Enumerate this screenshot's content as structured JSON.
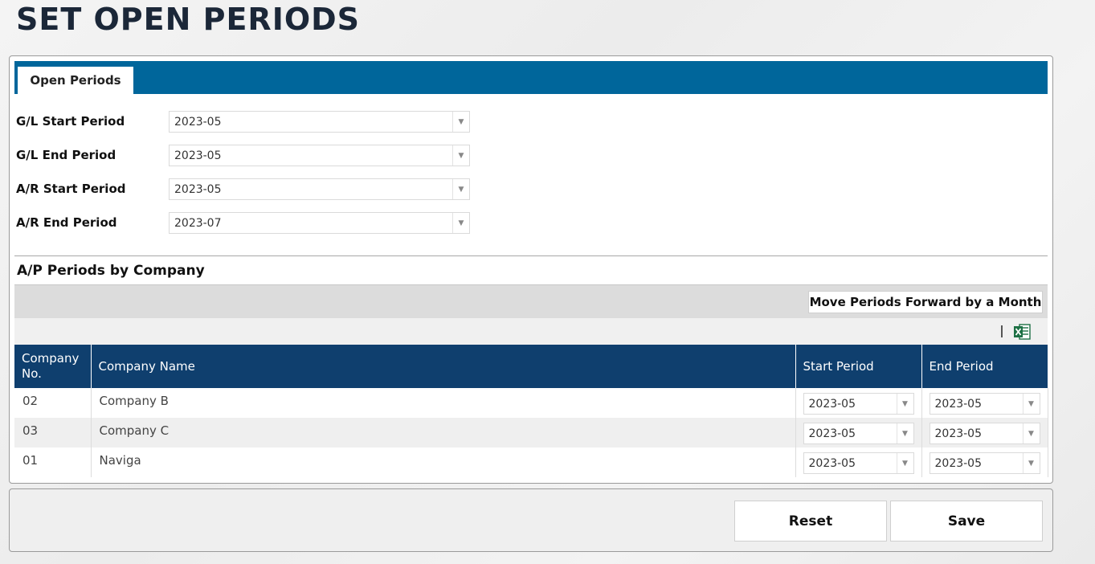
{
  "page": {
    "title": "SET OPEN PERIODS"
  },
  "tabs": [
    {
      "label": "Open Periods"
    }
  ],
  "periods": {
    "gl_start": {
      "label": "G/L Start Period",
      "value": "2023-05"
    },
    "gl_end": {
      "label": "G/L End Period",
      "value": "2023-05"
    },
    "ar_start": {
      "label": "A/R Start Period",
      "value": "2023-05"
    },
    "ar_end": {
      "label": "A/R End Period",
      "value": "2023-07"
    }
  },
  "ap_section": {
    "title": "A/P Periods by Company",
    "move_button_label": "Move Periods Forward by a Month",
    "excel_icon": "excel-export-icon",
    "columns": [
      {
        "line1": "Company",
        "line2": "No."
      },
      {
        "line1": "Company Name"
      },
      {
        "line1": "Start Period"
      },
      {
        "line1": "End Period"
      }
    ],
    "rows": [
      {
        "company_no": "02",
        "company_name": "Company B",
        "start": "2023-05",
        "end": "2023-05"
      },
      {
        "company_no": "03",
        "company_name": "Company C",
        "start": "2023-05",
        "end": "2023-05"
      },
      {
        "company_no": "01",
        "company_name": "Naviga",
        "start": "2023-05",
        "end": "2023-05"
      }
    ]
  },
  "actions": {
    "reset_label": "Reset",
    "save_label": "Save"
  },
  "colors": {
    "tab_bar": "#00669b",
    "table_header": "#0f3f6e",
    "excel_green": "#1d7044",
    "title_text": "#1b2738"
  }
}
